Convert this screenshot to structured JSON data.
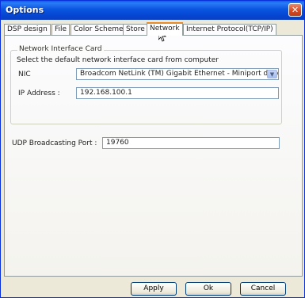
{
  "window": {
    "title": "Options",
    "close_glyph": "✕"
  },
  "tabs": [
    {
      "label": "DSP design"
    },
    {
      "label": "File"
    },
    {
      "label": "Color Scheme"
    },
    {
      "label": "Store"
    },
    {
      "label": "Network",
      "active": true
    },
    {
      "label": "Internet Protocol(TCP/IP)"
    }
  ],
  "network_card": {
    "group_title": "Network Interface Card",
    "description": "Select the default network interface card from computer",
    "nic_label": "NIC",
    "nic_value": "Broadcom NetLink (TM) Gigabit Ethernet - Miniport d'ordonn",
    "ip_label": "IP Address :",
    "ip_value": "192.168.100.1"
  },
  "udp": {
    "label": "UDP Broadcasting Port :",
    "value": "19760"
  },
  "buttons": {
    "apply": "Apply",
    "ok": "Ok",
    "cancel": "Cancel"
  },
  "icons": {
    "close": "close-icon",
    "dropdown": "chevron-down-icon",
    "cursor": "mouse-cursor-icon"
  }
}
